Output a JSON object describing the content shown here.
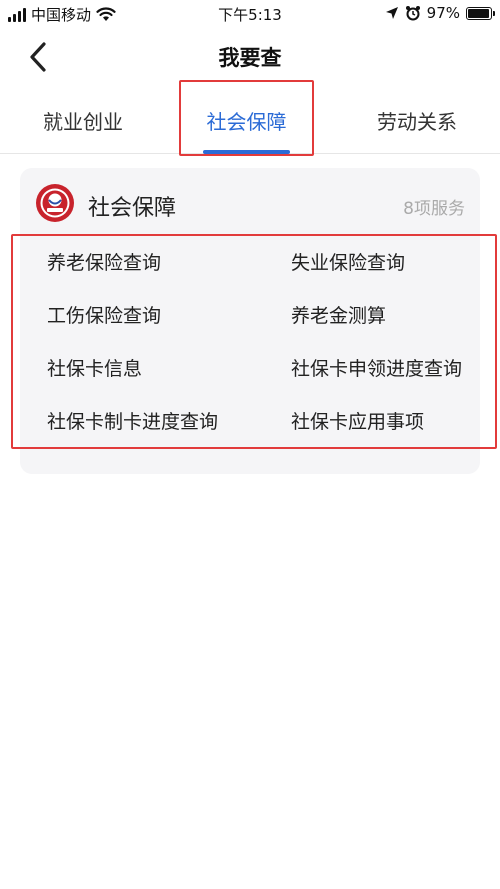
{
  "status_bar": {
    "carrier": "中国移动",
    "time": "下午5:13",
    "battery_percent_text": "97%",
    "battery_level": 0.97
  },
  "nav": {
    "title": "我要查"
  },
  "tabs": [
    {
      "label": "就业创业",
      "active": false
    },
    {
      "label": "社会保障",
      "active": true
    },
    {
      "label": "劳动关系",
      "active": false
    }
  ],
  "card": {
    "title": "社会保障",
    "count": "8项服务",
    "services": [
      "养老保险查询",
      "失业保险查询",
      "工伤保险查询",
      "养老金测算",
      "社保卡信息",
      "社保卡申领进度查询",
      "社保卡制卡进度查询",
      "社保卡应用事项"
    ]
  },
  "colors": {
    "accent": "#2b6bd6",
    "highlight": "#e23b3b",
    "logo_red": "#c8232c"
  },
  "icons": {
    "back": "chevron-left-icon",
    "wifi": "wifi-icon",
    "location": "location-arrow-icon",
    "alarm": "alarm-icon",
    "battery": "battery-icon",
    "logo": "social-security-logo"
  }
}
